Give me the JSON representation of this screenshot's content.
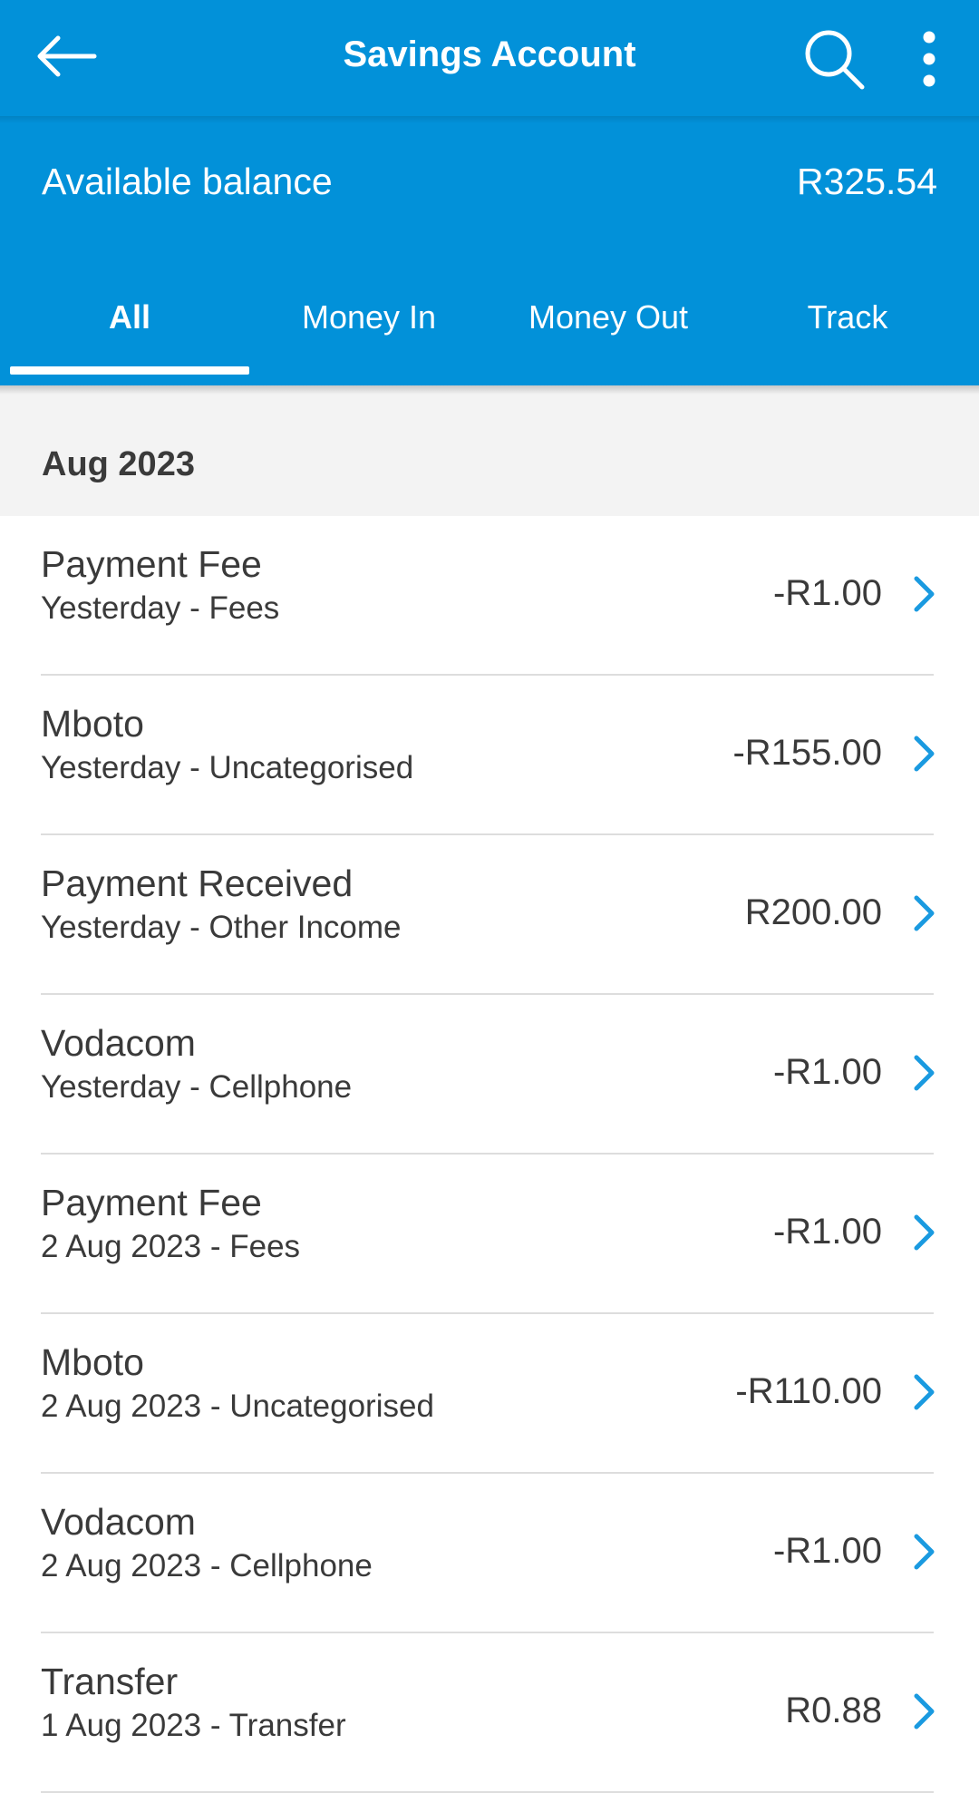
{
  "appbar": {
    "title": "Savings Account",
    "back_icon": "arrow-left-icon",
    "search_icon": "search-icon",
    "more_icon": "more-vertical-icon"
  },
  "balance": {
    "label": "Available balance",
    "value": "R325.54"
  },
  "tabs": [
    {
      "label": "All",
      "active": true
    },
    {
      "label": "Money In",
      "active": false
    },
    {
      "label": "Money Out",
      "active": false
    },
    {
      "label": "Track",
      "active": false
    }
  ],
  "section": {
    "title": "Aug 2023"
  },
  "transactions": [
    {
      "name": "Payment Fee",
      "sub": "Yesterday - Fees",
      "amount": "-R1.00"
    },
    {
      "name": "Mboto",
      "sub": "Yesterday - Uncategorised",
      "amount": "-R155.00"
    },
    {
      "name": "Payment Received",
      "sub": "Yesterday - Other Income",
      "amount": "R200.00"
    },
    {
      "name": "Vodacom",
      "sub": "Yesterday - Cellphone",
      "amount": "-R1.00"
    },
    {
      "name": "Payment Fee",
      "sub": "2 Aug 2023 - Fees",
      "amount": "-R1.00"
    },
    {
      "name": "Mboto",
      "sub": "2 Aug 2023 - Uncategorised",
      "amount": "-R110.00"
    },
    {
      "name": "Vodacom",
      "sub": "2 Aug 2023 - Cellphone",
      "amount": "-R1.00"
    },
    {
      "name": "Transfer",
      "sub": "1 Aug 2023 - Transfer",
      "amount": "R0.88"
    }
  ],
  "colors": {
    "header_blue": "#0291d9",
    "chevron_blue": "#1a9ae0",
    "section_bg": "#f3f3f3",
    "text": "#3a3a3a"
  }
}
